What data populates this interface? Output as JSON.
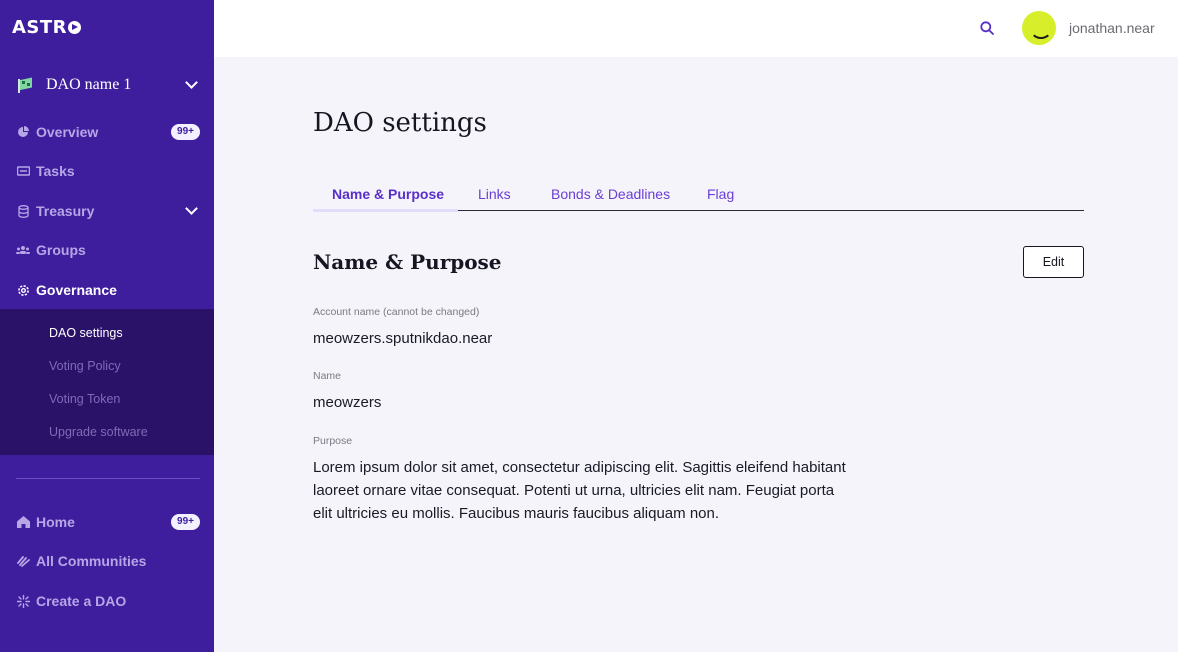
{
  "brand": {
    "logo_text": "ASTR"
  },
  "sidebar": {
    "dao_selector": {
      "name": "DAO name 1"
    },
    "nav": [
      {
        "label": "Overview",
        "icon": "pie-chart-icon",
        "badge": "99+"
      },
      {
        "label": "Tasks",
        "icon": "ticket-icon"
      },
      {
        "label": "Treasury",
        "icon": "coins-icon"
      },
      {
        "label": "Groups",
        "icon": "users-icon"
      },
      {
        "label": "Governance",
        "icon": "gear-icon"
      }
    ],
    "governance_sub": [
      {
        "label": "DAO settings"
      },
      {
        "label": "Voting Policy"
      },
      {
        "label": "Voting Token"
      },
      {
        "label": "Upgrade software"
      }
    ],
    "bottom_nav": [
      {
        "label": "Home",
        "icon": "home-icon",
        "badge": "99+"
      },
      {
        "label": "All Communities",
        "icon": "communities-icon"
      },
      {
        "label": "Create a DAO",
        "icon": "sparkle-icon"
      }
    ]
  },
  "header": {
    "username": "jonathan.near"
  },
  "main": {
    "title": "DAO settings",
    "tabs": [
      {
        "label": "Name & Purpose"
      },
      {
        "label": "Links"
      },
      {
        "label": "Bonds & Deadlines"
      },
      {
        "label": "Flag"
      }
    ],
    "section_title": "Name & Purpose",
    "edit_label": "Edit",
    "fields": {
      "account_label": "Account name (cannot be changed)",
      "account_value": "meowzers.sputnikdao.near",
      "name_label": "Name",
      "name_value": "meowzers",
      "purpose_label": "Purpose",
      "purpose_value": "Lorem ipsum dolor sit amet, consectetur adipiscing elit. Sagittis eleifend habitant laoreet ornare vitae consequat. Potenti ut urna, ultricies elit nam. Feugiat porta elit ultricies eu mollis. Faucibus mauris faucibus aliquam non."
    }
  },
  "colors": {
    "sidebar_bg": "#3f1e9e",
    "subnav_bg": "#2a1268",
    "accent": "#5a2fc9",
    "avatar_bg": "#d6ef2a"
  }
}
